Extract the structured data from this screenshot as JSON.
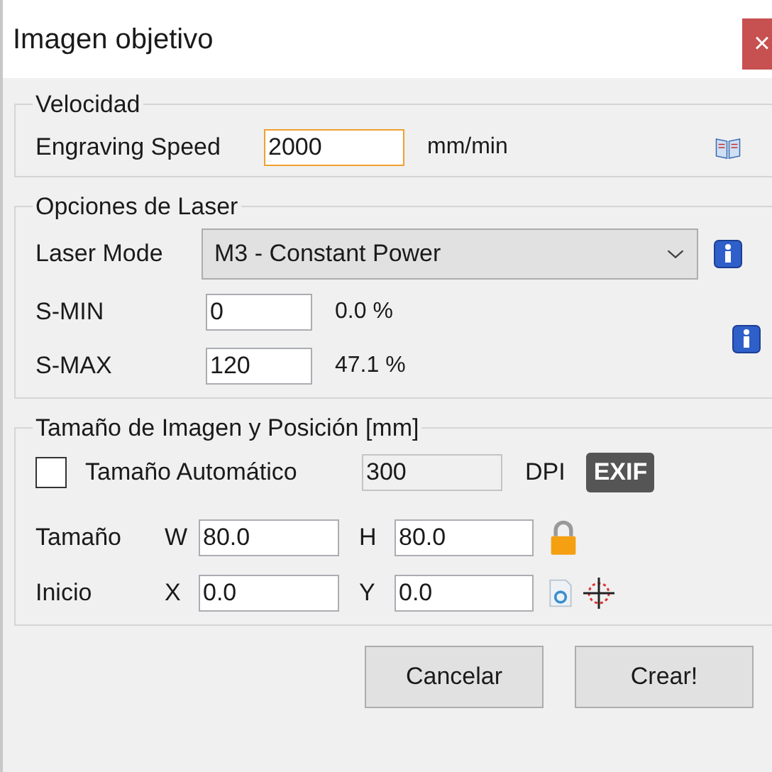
{
  "window": {
    "title": "Imagen objetivo",
    "close": "×"
  },
  "speed_group": {
    "legend": "Velocidad",
    "label": "Engraving Speed",
    "value": "2000",
    "focused": true,
    "unit": "mm/min"
  },
  "laser_group": {
    "legend": "Opciones de Laser",
    "mode_label": "Laser Mode",
    "mode_value": "M3 - Constant Power",
    "rows": [
      {
        "label": "S-MIN",
        "value": "0",
        "percent": "0.0 %"
      },
      {
        "label": "S-MAX",
        "value": "120",
        "percent": "47.1 %"
      }
    ]
  },
  "size_group": {
    "legend": "Tamaño de Imagen y Posición [mm]",
    "auto_size": {
      "label": "Tamaño Automático",
      "checked": false
    },
    "dpi_value": "300",
    "dpi_disabled": true,
    "dpi_label": "DPI",
    "exif": "EXIF",
    "rows": [
      {
        "label": "Tamaño",
        "kind": "size",
        "a_label": "W",
        "a_value": "80.0",
        "b_label": "H",
        "b_value": "80.0"
      },
      {
        "label": "Inicio",
        "kind": "origin",
        "a_label": "X",
        "a_value": "0.0",
        "b_label": "Y",
        "b_value": "0.0"
      }
    ]
  },
  "buttons": [
    "Cancelar",
    "Crear!"
  ]
}
